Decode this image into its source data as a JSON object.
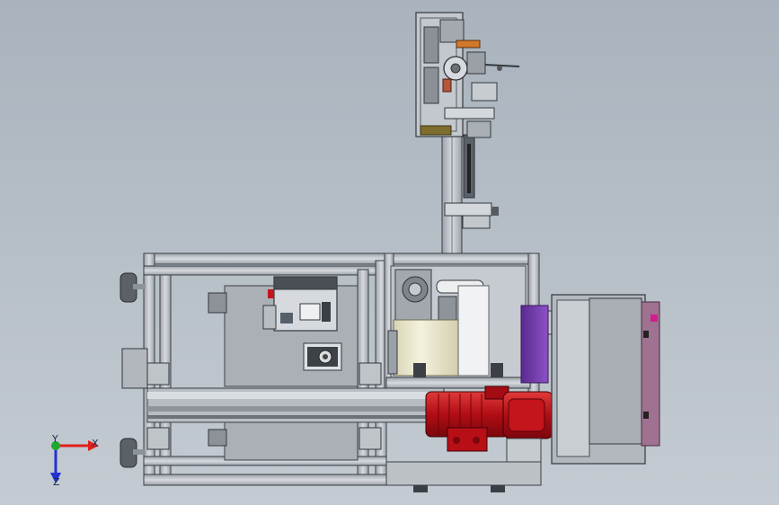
{
  "viewport": {
    "background_top": "#a9b3bd",
    "background_bottom": "#c4cbd2"
  },
  "triad": {
    "x_label": "X",
    "y_label": "Y",
    "z_label": "Z",
    "x_color": "#e0201c",
    "y_color": "#1fa830",
    "z_color": "#2233d0"
  },
  "colors": {
    "profile": "#c9ced4",
    "plate": "#b3b9bf",
    "motor_red": "#c4141c",
    "purple_panel": "#7a3fb0",
    "cream_roll": "#ece9cf",
    "orange_accent": "#d2782a",
    "dark_part": "#3c4046"
  }
}
